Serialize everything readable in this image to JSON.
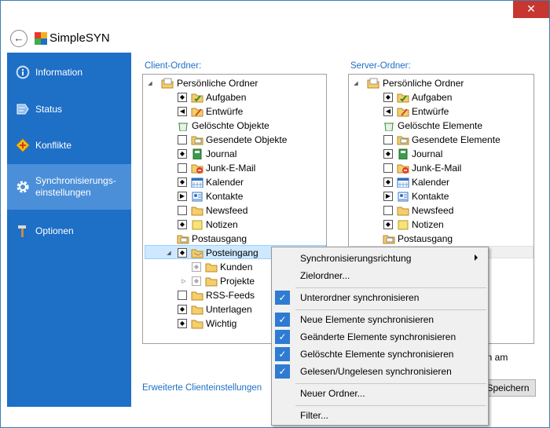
{
  "window": {
    "title": "SimpleSYN",
    "close_glyph": "✕"
  },
  "back_glyph": "←",
  "sidebar": {
    "items": [
      {
        "label": "Information",
        "icon": "info-icon"
      },
      {
        "label": "Status",
        "icon": "status-icon"
      },
      {
        "label": "Konflikte",
        "icon": "conflicts-icon"
      },
      {
        "label": "Synchronisierungs-\neinstellungen",
        "icon": "gear-icon",
        "selected": true
      },
      {
        "label": "Optionen",
        "icon": "hammer-icon"
      }
    ]
  },
  "client": {
    "label": "Client-Ordner:",
    "root": "Persönliche Ordner",
    "items": [
      "Aufgaben",
      "Entwürfe",
      "Gelöschte Objekte",
      "Gesendete Objekte",
      "Journal",
      "Junk-E-Mail",
      "Kalender",
      "Kontakte",
      "Newsfeed",
      "Notizen",
      "Postausgang",
      "Posteingang",
      "Kunden",
      "Projekte",
      "RSS-Feeds",
      "Unterlagen",
      "Wichtig"
    ]
  },
  "server": {
    "label": "Server-Ordner:",
    "root": "Persönliche Ordner",
    "items": [
      "Aufgaben",
      "Entwürfe",
      "Gelöschte Elemente",
      "Gesendete Elemente",
      "Journal",
      "Junk-E-Mail",
      "Kalender",
      "Kontakte",
      "Newsfeed",
      "Notizen",
      "Postausgang"
    ]
  },
  "links": {
    "client_settings": "Erweiterte Clienteinstellungen"
  },
  "buttons": {
    "save": "Speichern"
  },
  "partial_text": "en am",
  "context_menu": {
    "items": [
      {
        "label": "Synchronisierungsrichtung",
        "submenu": true
      },
      {
        "label": "Zielordner..."
      },
      {
        "label": "Unterordner synchronisieren",
        "checked": true
      },
      {
        "label": "Neue Elemente synchronisieren",
        "checked": true
      },
      {
        "label": "Geänderte Elemente synchronisieren",
        "checked": true
      },
      {
        "label": "Gelöschte Elemente synchronisieren",
        "checked": true
      },
      {
        "label": "Gelesen/Ungelesen synchronisieren",
        "checked": true
      },
      {
        "label": "Neuer Ordner..."
      },
      {
        "label": "Filter..."
      }
    ],
    "check_glyph": "✓"
  },
  "colors": {
    "accent": "#1e6fc6",
    "sidebar_selected": "#4c8fd9",
    "close": "#c7372f",
    "menu_check": "#2f7bd2"
  }
}
